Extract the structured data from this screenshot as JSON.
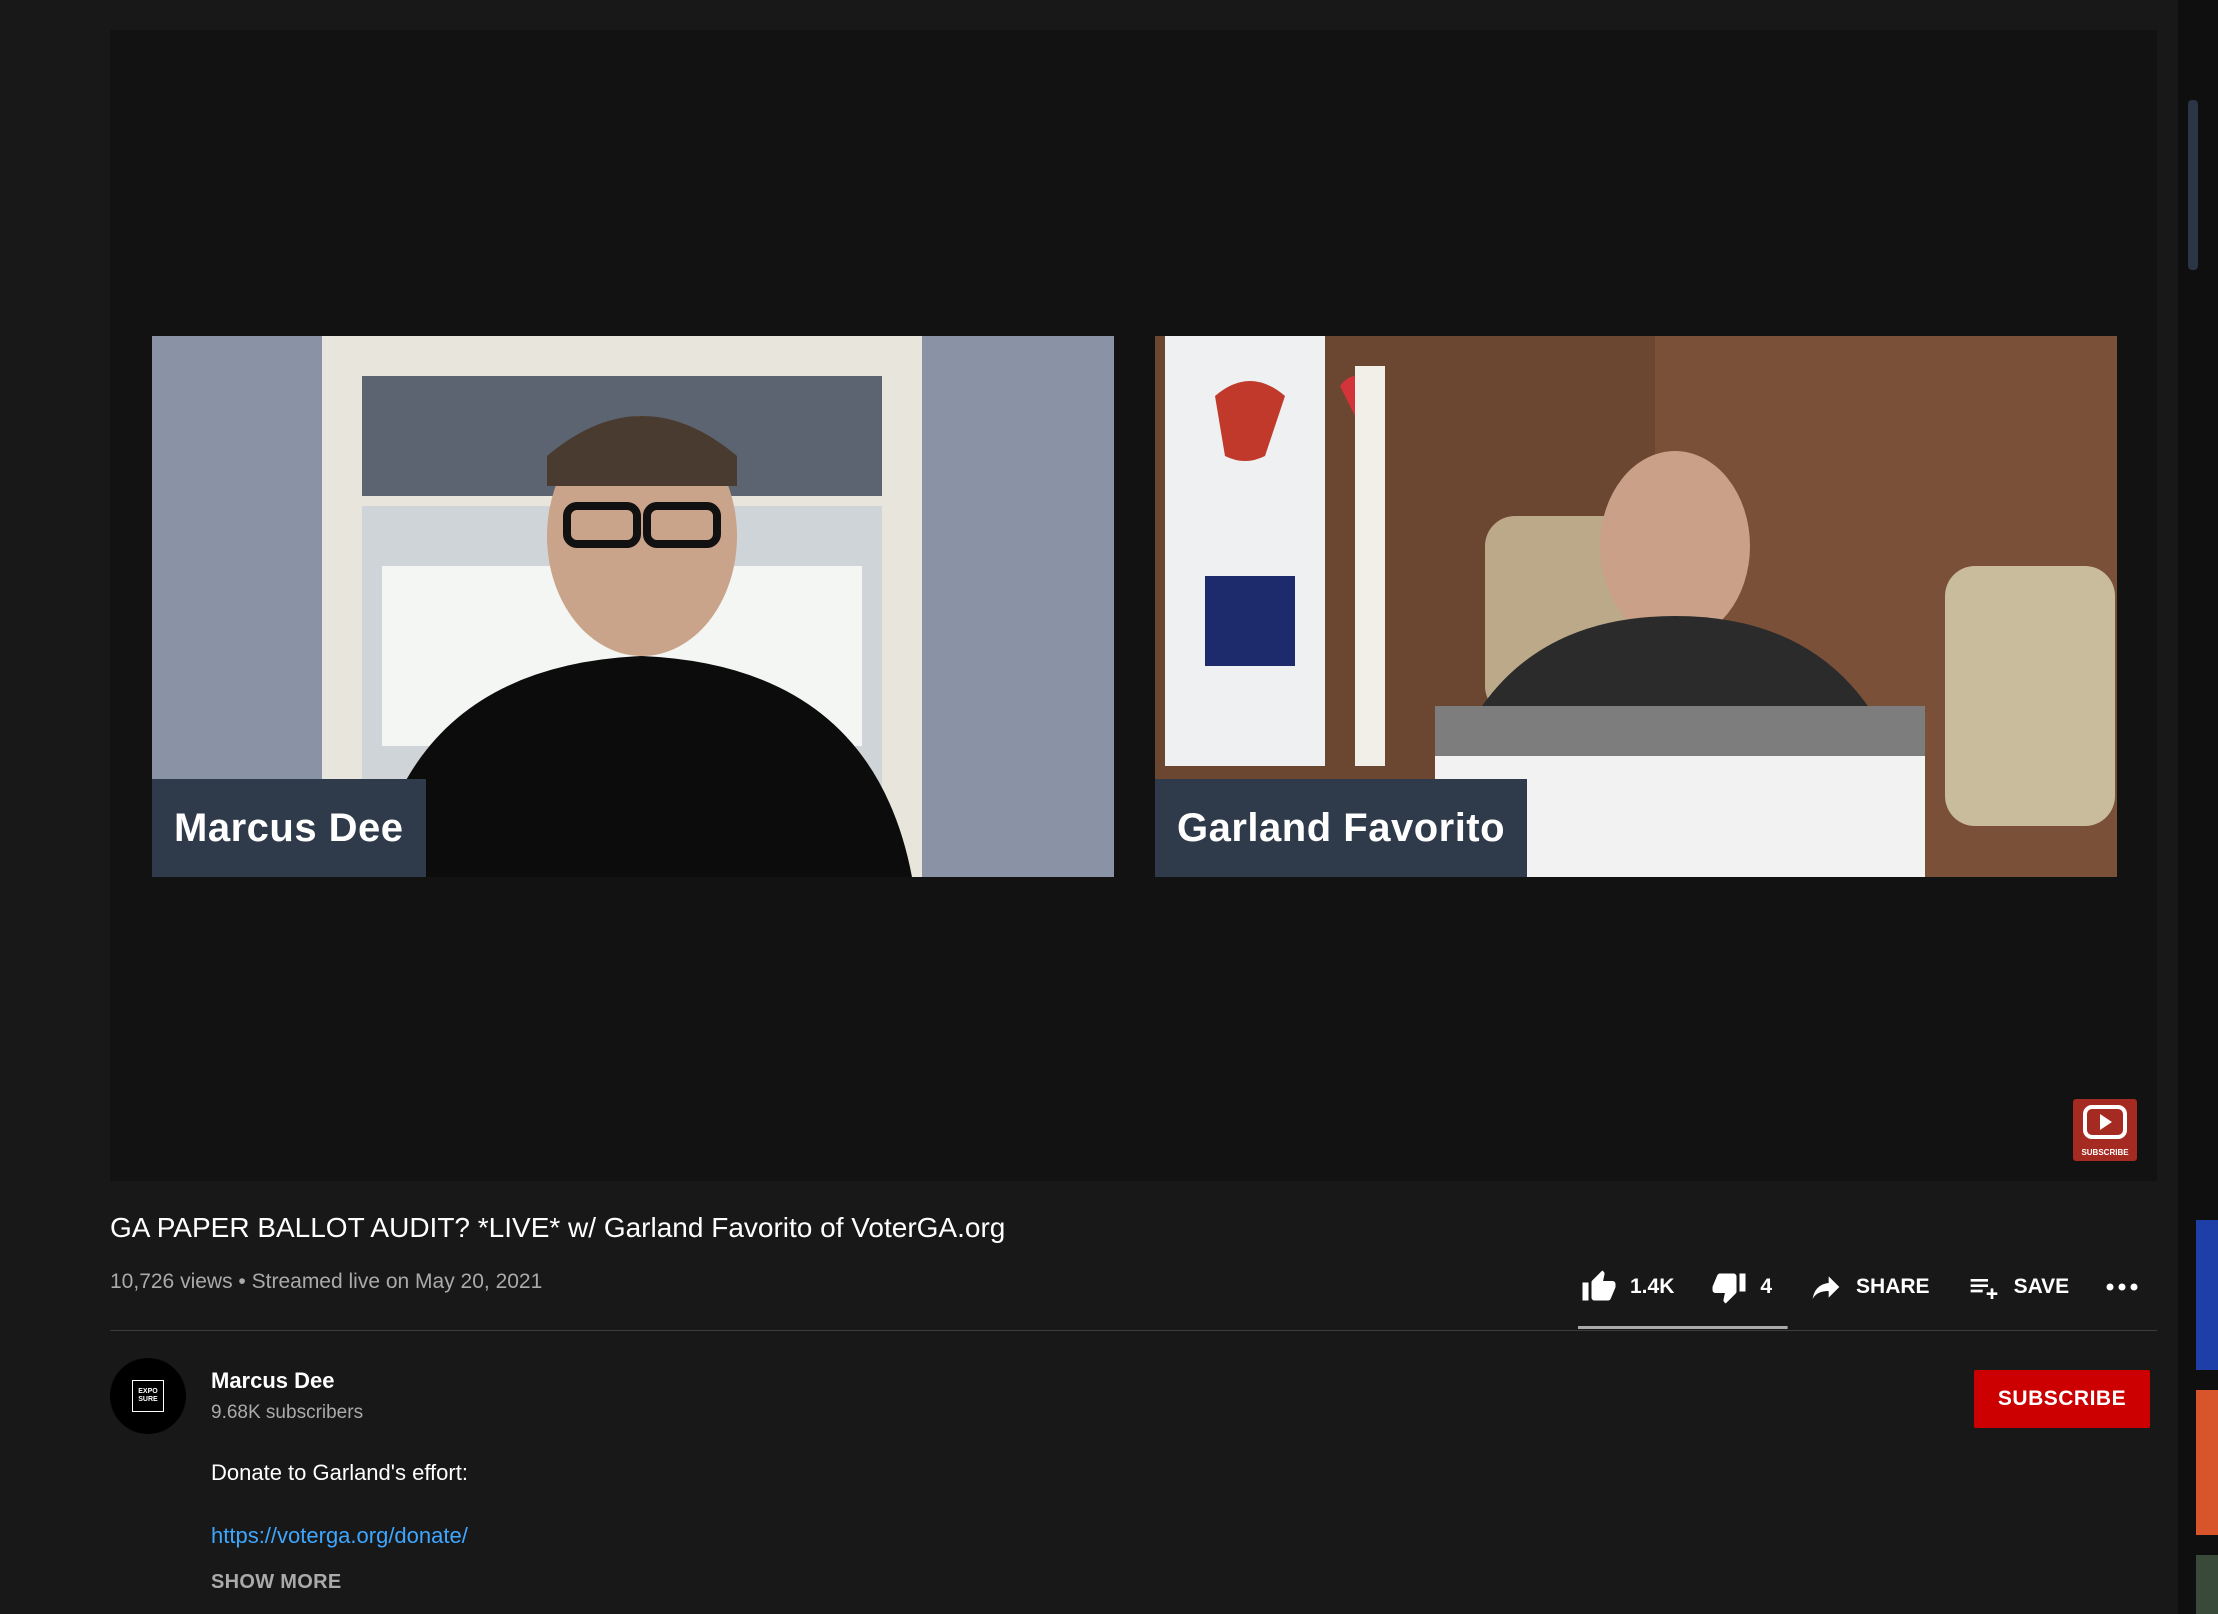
{
  "player": {
    "participants": [
      {
        "name": "Marcus Dee"
      },
      {
        "name": "Garland Favorito"
      }
    ],
    "watermark_label": "SUBSCRIBE"
  },
  "video": {
    "title": "GA PAPER BALLOT AUDIT? *LIVE* w/ Garland Favorito of VoterGA.org",
    "views": "10,726 views",
    "separator": "•",
    "date": "Streamed live on May 20, 2021"
  },
  "actions": {
    "like_count": "1.4K",
    "dislike_count": "4",
    "share_label": "SHARE",
    "save_label": "SAVE",
    "like_ratio": 0.997
  },
  "channel": {
    "avatar_text": "EXPO SURE",
    "name": "Marcus Dee",
    "subscribers": "9.68K subscribers",
    "subscribe_label": "SUBSCRIBE"
  },
  "description": {
    "line1": "Donate to Garland's effort:",
    "link": "https://voterga.org/donate/",
    "show_more": "SHOW MORE"
  },
  "colors": {
    "background": "#181818",
    "accent_red": "#cc0000",
    "link_blue": "#3ea6ff",
    "nameplate": "#2f3a4a"
  }
}
